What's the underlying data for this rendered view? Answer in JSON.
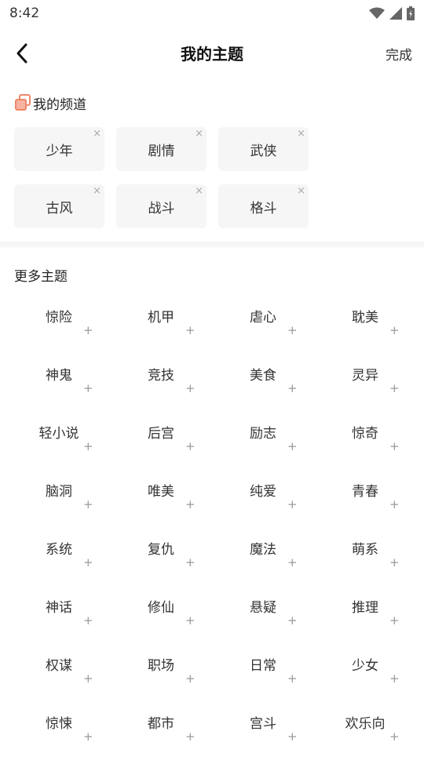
{
  "status": {
    "time": "8:42"
  },
  "nav": {
    "title": "我的主题",
    "done_label": "完成"
  },
  "my_channels": {
    "title": "我的频道",
    "close_glyph": "×",
    "items": [
      {
        "label": "少年"
      },
      {
        "label": "剧情"
      },
      {
        "label": "武侠"
      },
      {
        "label": "古风"
      },
      {
        "label": "战斗"
      },
      {
        "label": "格斗"
      }
    ]
  },
  "more_topics": {
    "title": "更多主题",
    "add_glyph": "+",
    "items": [
      {
        "label": "惊险"
      },
      {
        "label": "机甲"
      },
      {
        "label": "虐心"
      },
      {
        "label": "耽美"
      },
      {
        "label": "神鬼"
      },
      {
        "label": "竞技"
      },
      {
        "label": "美食"
      },
      {
        "label": "灵异"
      },
      {
        "label": "轻小说"
      },
      {
        "label": "后宫"
      },
      {
        "label": "励志"
      },
      {
        "label": "惊奇"
      },
      {
        "label": "脑洞"
      },
      {
        "label": "唯美"
      },
      {
        "label": "纯爱"
      },
      {
        "label": "青春"
      },
      {
        "label": "系统"
      },
      {
        "label": "复仇"
      },
      {
        "label": "魔法"
      },
      {
        "label": "萌系"
      },
      {
        "label": "神话"
      },
      {
        "label": "修仙"
      },
      {
        "label": "悬疑"
      },
      {
        "label": "推理"
      },
      {
        "label": "权谋"
      },
      {
        "label": "职场"
      },
      {
        "label": "日常"
      },
      {
        "label": "少女"
      },
      {
        "label": "惊悚"
      },
      {
        "label": "都市"
      },
      {
        "label": "宫斗"
      },
      {
        "label": "欢乐向"
      }
    ]
  },
  "colors": {
    "accent": "#f0876a",
    "chip_bg": "#f6f6f6"
  },
  "icons": {
    "back": "chevron-left-icon",
    "channel": "layers-icon",
    "wifi": "wifi-icon",
    "signal": "signal-icon",
    "battery": "battery-icon"
  }
}
